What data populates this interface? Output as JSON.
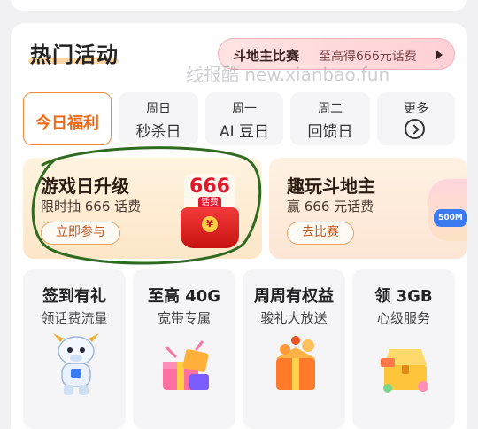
{
  "section": {
    "title": "热门活动",
    "promo": {
      "main": "斗地主比赛",
      "sub": "至高得666元话费"
    },
    "watermark": "线报酷 new.xianbao.fun"
  },
  "tabs": [
    {
      "label": "今日福利",
      "active": true
    },
    {
      "day": "周日",
      "name": "秒杀日"
    },
    {
      "day": "周一",
      "name": "AI 豆日"
    },
    {
      "day": "周二",
      "name": "回馈日"
    },
    {
      "day": "更多",
      "icon": "chevron-right-circle-icon"
    }
  ],
  "activities": [
    {
      "title": "游戏日升级",
      "sub": "限时抽 666 话费",
      "button": "立即参与",
      "badge_number": "666",
      "badge_fee": "话费",
      "coin": "¥"
    },
    {
      "title": "趣玩斗地主",
      "sub": "赢 666 元话费",
      "button": "去比赛",
      "tag": "500M"
    }
  ],
  "services": [
    {
      "title": "签到有礼",
      "sub": "领话费流量",
      "icon": "mascot-ox-icon"
    },
    {
      "title": "至高 40G",
      "sub": "宽带专属",
      "icon": "gift-box-pink-icon"
    },
    {
      "title": "周周有权益",
      "sub": "骏礼大放送",
      "icon": "gift-box-orange-icon"
    },
    {
      "title": "领 3GB",
      "sub": "心级服务",
      "icon": "treasure-chest-icon"
    }
  ],
  "colors": {
    "accent": "#f06a16",
    "red": "#e0182d",
    "circle": "#2e6b1f"
  }
}
